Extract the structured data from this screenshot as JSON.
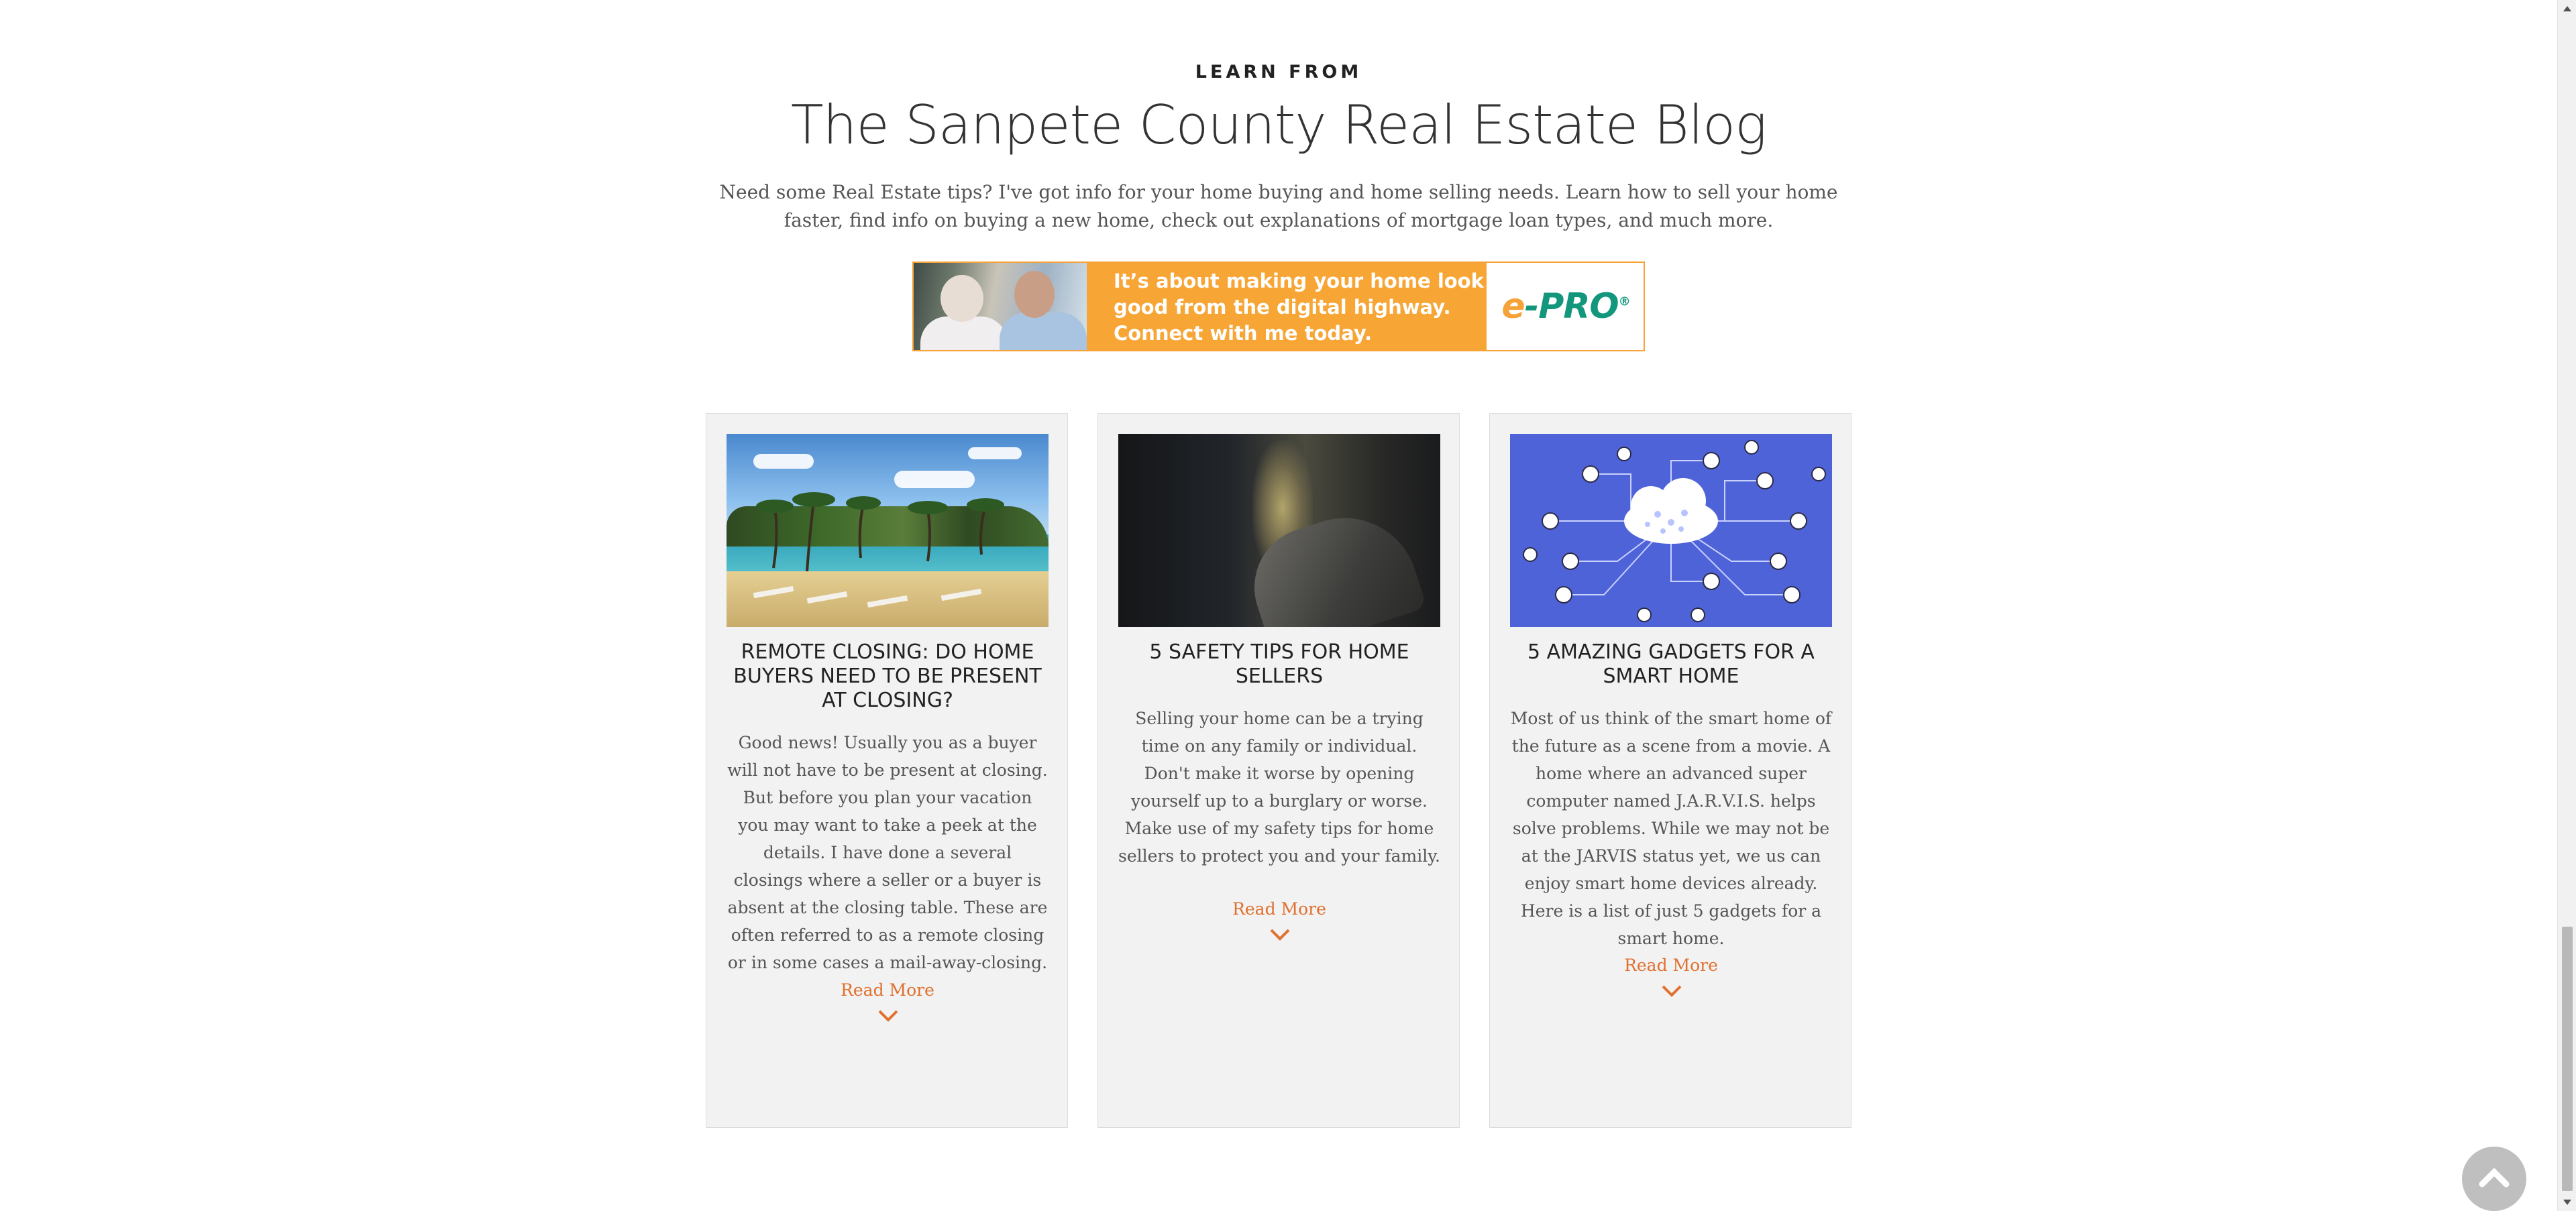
{
  "section": {
    "eyebrow": "LEARN FROM",
    "title": "The Sanpete County Real Estate Blog",
    "intro": "Need some Real Estate tips? I've got info for your home buying and home selling needs. Learn how to sell your home faster, find info on buying a new home, check out explanations of mortgage loan types, and much more."
  },
  "banner": {
    "lines": [
      "It’s about making your home look",
      "good from the digital highway.",
      "Connect with me today."
    ],
    "logo_e": "e",
    "logo_rest": "-PRO",
    "logo_reg": "®",
    "colors": {
      "orange": "#f7a535",
      "teal": "#12967c"
    }
  },
  "posts": [
    {
      "title": "REMOTE CLOSING: DO HOME BUYERS NEED TO BE PRESENT AT CLOSING?",
      "excerpt": "Good news! Usually you as a buyer will not have to be present at closing. But before you plan your vacation you may want to take a peek at the details. I have done a several closings where a seller or a buyer is absent at the closing table. These are often referred to as a remote closing or in some cases a mail-away-closing.",
      "read_more": "Read More",
      "image": "beach-photo"
    },
    {
      "title": "5 SAFETY TIPS FOR HOME SELLERS",
      "excerpt": "Selling your home can be a trying time on any family or individual. Don't make it worse by opening yourself up to a burglary or worse. Make use of my safety tips for home sellers to protect you and your family.",
      "read_more": "Read More",
      "image": "burglar-photo"
    },
    {
      "title": "5 AMAZING GADGETS FOR A SMART HOME",
      "excerpt": "Most of us think of the smart home of the future as a scene from a movie. A home where an advanced super computer named J.A.R.V.I.S. helps solve problems. While we may not be at the JARVIS status yet, we us can enjoy smart home devices already. Here is a list of just 5 gadgets for a smart home.",
      "read_more": "Read More",
      "image": "smart-home-cloud-illustration"
    }
  ],
  "colors": {
    "accent": "#e0702e",
    "card_bg": "#f2f2f2",
    "tech_blue": "#4f63d8"
  },
  "icons": {
    "read_more": "chevron-down-icon",
    "scroll_top": "chevron-up-icon"
  }
}
